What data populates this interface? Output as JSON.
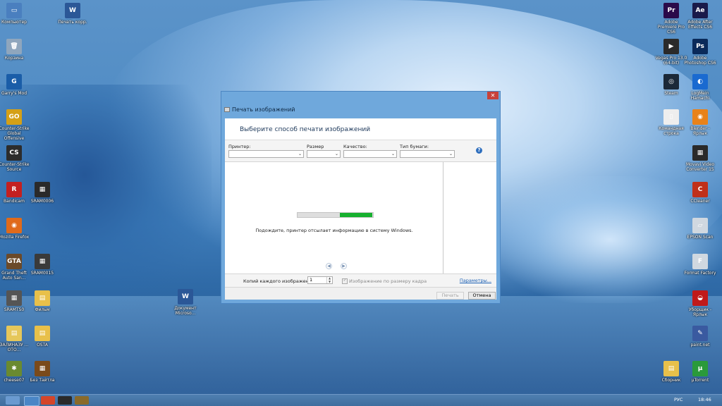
{
  "desktop": {
    "icons_left": [
      {
        "label": "Компьютер",
        "color": "#4a7fbf",
        "glyph": "▭"
      },
      {
        "label": "Корзина",
        "color": "#8fa6bd",
        "glyph": "🗑"
      },
      {
        "label": "Garry's Mod",
        "color": "#1a5da8",
        "glyph": "G"
      },
      {
        "label": "Counter-Strike Global Offensive",
        "color": "#d4a017",
        "glyph": "GO"
      },
      {
        "label": "Counter-Strike Source",
        "color": "#2c2c2c",
        "glyph": "CS"
      },
      {
        "label": "Bandicam",
        "color": "#c42020",
        "glyph": "R"
      },
      {
        "label": "Mozilla Firefox",
        "color": "#e06a1a",
        "glyph": "◉"
      },
      {
        "label": "Grand Theft Auto San...",
        "color": "#6b4a2a",
        "glyph": "GTA"
      },
      {
        "label": "SRAMTS0",
        "color": "#555555",
        "glyph": "▦"
      },
      {
        "label": "ЗАЛИНАЗУ ... ОТО...",
        "color": "#e6c75a",
        "glyph": "▤"
      },
      {
        "label": "cheese07",
        "color": "#6a8a30",
        "glyph": "✱"
      }
    ],
    "icons_col2": [
      {
        "label": "Печать корр.",
        "color": "#2b5797",
        "glyph": "W"
      },
      {
        "label": "SRAM0006",
        "color": "#2a2a2a",
        "glyph": "▦"
      },
      {
        "label": "SRAM0015",
        "color": "#3a3a3a",
        "glyph": "▦"
      },
      {
        "label": "Фильм",
        "color": "#e8c04a",
        "glyph": "▤"
      },
      {
        "label": "OSTA",
        "color": "#e8c04a",
        "glyph": "▤"
      },
      {
        "label": "Без Тайтла",
        "color": "#7a4a1a",
        "glyph": "▦"
      }
    ],
    "icon_doc": {
      "label": "Документ Microso...",
      "color": "#2b5797",
      "glyph": "W"
    },
    "icons_right_col1": [
      {
        "label": "Adobe Premiere Pro CS6",
        "color": "#2a0a4a",
        "glyph": "Pr"
      },
      {
        "label": "Vegas Pro 13.0 (64-bit)",
        "color": "#2a2a2a",
        "glyph": "▶"
      },
      {
        "label": "Steam",
        "color": "#1b2838",
        "glyph": "◎"
      },
      {
        "label": "Командная строка",
        "color": "#eeeeee",
        "glyph": "▯"
      },
      {
        "label": "Сборник",
        "color": "#e8c04a",
        "glyph": "▤"
      }
    ],
    "icons_right_col2": [
      {
        "label": "Adobe After Effects CS6",
        "color": "#1a1a4a",
        "glyph": "Ae"
      },
      {
        "label": "Adobe Photoshop CS6",
        "color": "#0a2a5a",
        "glyph": "Ps"
      },
      {
        "label": "LogMeIn Hamachi",
        "color": "#1a6ad0",
        "glyph": "◐"
      },
      {
        "label": "Blender - Ярлык",
        "color": "#e8821a",
        "glyph": "◉"
      },
      {
        "label": "Movavi Video Converter 15",
        "color": "#2a2a2a",
        "glyph": "▦"
      },
      {
        "label": "CCleaner",
        "color": "#c0301a",
        "glyph": "C"
      },
      {
        "label": "EPSON Scan",
        "color": "#d0d8e0",
        "glyph": "▱"
      },
      {
        "label": "Format Factory",
        "color": "#d0d8e0",
        "glyph": "F"
      },
      {
        "label": "Уборщик - Ярлык",
        "color": "#c01a1a",
        "glyph": "◒"
      },
      {
        "label": "paint.net",
        "color": "#3a5aa0",
        "glyph": "✎"
      },
      {
        "label": "µTorrent",
        "color": "#2a9a3a",
        "glyph": "µ"
      }
    ]
  },
  "dialog": {
    "title": "Печать изображений",
    "close_glyph": "✕",
    "header": "Выберите способ печати изображений",
    "printer_label": "Принтер:",
    "paper_size_label": "Размер бумаги:",
    "quality_label": "Качество:",
    "paper_type_label": "Тип бумаги:",
    "help_glyph": "?",
    "progress_fraction": 0.43,
    "message": "Подождите, принтер отсылает информацию в систему Windows.",
    "prev_glyph": "◀",
    "next_glyph": "▶",
    "copies_label": "Копий каждого изображения:",
    "copies_value": "1",
    "fit_label": "Изображение по размеру кадра",
    "params_link": "Параметры...",
    "print_button": "Печать",
    "cancel_button": "Отмена"
  },
  "taskbar": {
    "language": "РУС",
    "time": "18:46"
  }
}
